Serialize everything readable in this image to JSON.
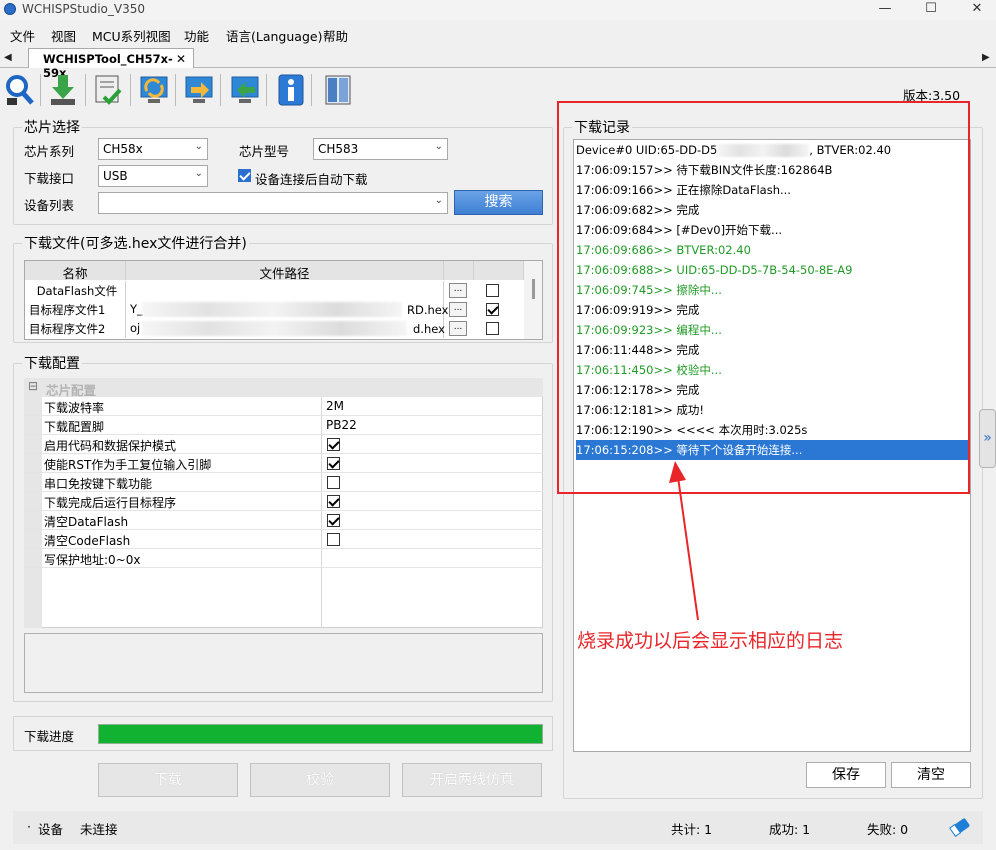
{
  "window": {
    "title": "WCHISPStudio_V350",
    "minimize": "—",
    "maximize": "☐",
    "close": "✕"
  },
  "menu": [
    "文件",
    "视图",
    "MCU系列视图",
    "功能",
    "语言(Language)",
    "帮助"
  ],
  "tabs": {
    "active": "WCHISPTool_CH57x-59x",
    "close": "✕",
    "left_arrow": "◀",
    "right_arrow": "▶"
  },
  "toolbar": {
    "version": "版本:3.50",
    "icons": [
      "chip-search-icon",
      "download-icon",
      "verify-icon",
      "refresh-icon",
      "import-icon",
      "export-icon",
      "info-icon",
      "book-icon"
    ]
  },
  "chip_select": {
    "title": "芯片选择",
    "series_label": "芯片系列",
    "series_value": "CH58x",
    "model_label": "芯片型号",
    "model_value": "CH583",
    "port_label": "下载接口",
    "port_value": "USB",
    "auto_download_label": "设备连接后自动下载",
    "auto_download": true,
    "device_list_label": "设备列表",
    "device_list_value": "",
    "search_button": "搜索"
  },
  "download_file": {
    "title": "下载文件(可多选.hex文件进行合并)",
    "col_name": "名称",
    "col_path": "文件路径",
    "rows": [
      {
        "name": "DataFlash文件",
        "path": "",
        "browse": "...",
        "checked": false
      },
      {
        "name": "目标程序文件1",
        "path": "Y_",
        "path_tail": "RD.hex",
        "browse": "...",
        "checked": true
      },
      {
        "name": "目标程序文件2",
        "path": "oj",
        "path_tail": "d.hex",
        "browse": "...",
        "checked": false
      }
    ]
  },
  "download_config": {
    "title": "下载配置",
    "category": "芯片配置",
    "collapse": "⊟",
    "rows": [
      {
        "name": "下载波特率",
        "value": "2M"
      },
      {
        "name": "下载配置脚",
        "value": "PB22"
      },
      {
        "name": "启用代码和数据保护模式",
        "checked": true
      },
      {
        "name": "使能RST作为手工复位输入引脚",
        "checked": true
      },
      {
        "name": "串口免按键下载功能",
        "checked": false
      },
      {
        "name": "下载完成后运行目标程序",
        "checked": true
      },
      {
        "name": "清空DataFlash",
        "checked": true
      },
      {
        "name": "清空CodeFlash",
        "checked": false
      },
      {
        "name": "写保护地址:0~0x",
        "value": ""
      }
    ]
  },
  "progress": {
    "label": "下载进度",
    "fraction": 1.0
  },
  "actions": {
    "download": "下载",
    "verify": "校验",
    "debug": "开启两线仿真"
  },
  "log": {
    "title": "下载记录",
    "lines": [
      {
        "text": "Device#0  UID:65-DD-D5",
        "tail": ", BTVER:02.40",
        "color": "black"
      },
      {
        "text": "17:06:09:157>> 待下载BIN文件长度:162864B",
        "color": "black"
      },
      {
        "text": "17:06:09:166>> 正在擦除DataFlash...",
        "color": "black"
      },
      {
        "text": "17:06:09:682>> 完成",
        "color": "black"
      },
      {
        "text": "17:06:09:684>> [#Dev0]开始下载...",
        "color": "black"
      },
      {
        "text": "17:06:09:686>> BTVER:02.40",
        "color": "green"
      },
      {
        "text": "17:06:09:688>> UID:65-DD-D5-7B-54-50-8E-A9",
        "color": "green"
      },
      {
        "text": "17:06:09:745>> 擦除中...",
        "color": "green"
      },
      {
        "text": "17:06:09:919>> 完成",
        "color": "black"
      },
      {
        "text": "17:06:09:923>> 编程中...",
        "color": "green"
      },
      {
        "text": "17:06:11:448>> 完成",
        "color": "black"
      },
      {
        "text": "17:06:11:450>> 校验中...",
        "color": "green"
      },
      {
        "text": "17:06:12:178>> 完成",
        "color": "black"
      },
      {
        "text": "17:06:12:181>> 成功!",
        "color": "black"
      },
      {
        "text": "17:06:12:190>> <<<< 本次用时:3.025s",
        "color": "black"
      },
      {
        "text": "17:06:15:208>> 等待下个设备开始连接...",
        "color": "selected"
      }
    ],
    "save_button": "保存",
    "clear_button": "清空",
    "annotation": "烧录成功以后会显示相应的日志",
    "side_handle": "»"
  },
  "status": {
    "bullet": "·",
    "device_label": "设备",
    "device_state": "未连接",
    "total": "共计: 1",
    "success": "成功: 1",
    "fail": "失败: 0"
  },
  "colors": {
    "progress": "#11b131",
    "log_green": "#1f9a25",
    "selection": "#2b78d4",
    "annotation": "#e8262a",
    "search_button": "#3f7fd3"
  }
}
